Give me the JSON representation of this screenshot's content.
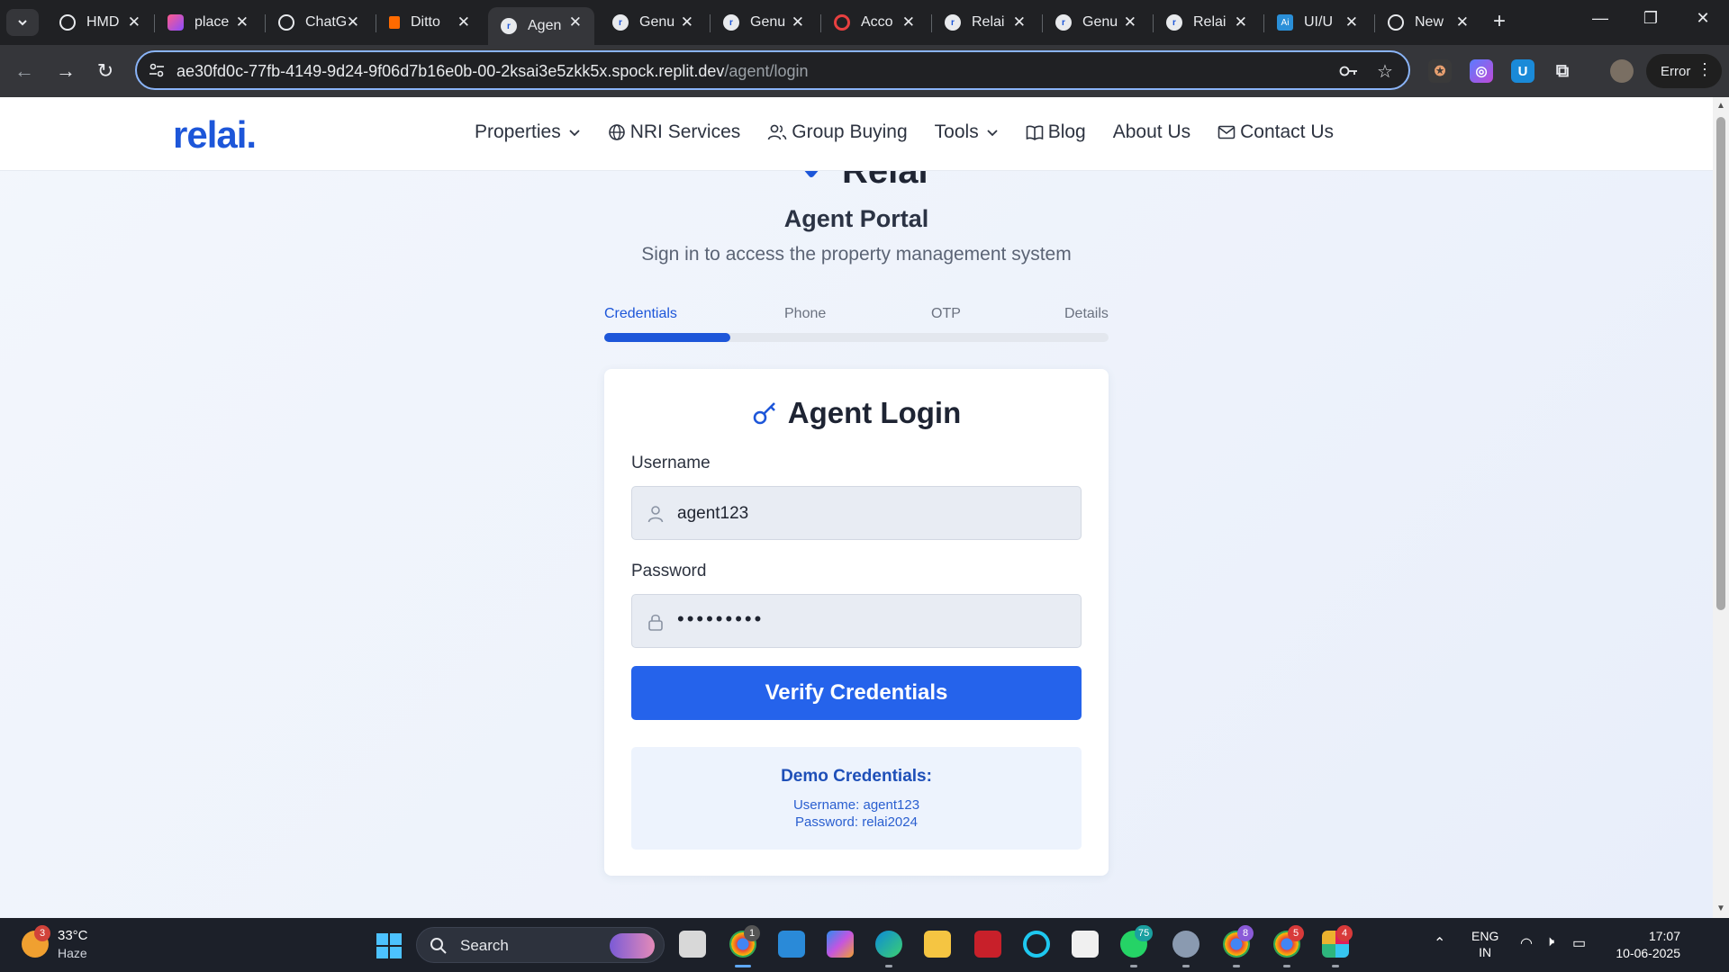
{
  "browser": {
    "tabs": [
      {
        "title": "HMD",
        "active": false
      },
      {
        "title": "place",
        "active": false
      },
      {
        "title": "ChatG",
        "active": false
      },
      {
        "title": "Ditto",
        "active": false
      },
      {
        "title": "Agen",
        "active": true
      },
      {
        "title": "Genu",
        "active": false
      },
      {
        "title": "Genu",
        "active": false
      },
      {
        "title": "Acco",
        "active": false
      },
      {
        "title": "Relai",
        "active": false
      },
      {
        "title": "Genu",
        "active": false
      },
      {
        "title": "Relai",
        "active": false
      },
      {
        "title": "UI/U",
        "active": false
      },
      {
        "title": "New",
        "active": false
      }
    ],
    "url_host": "ae30fd0c-77fb-4149-9d24-9f06d7b16e0b-00-2ksai3e5zkk5x.spock.replit.dev",
    "url_path": "/agent/login",
    "profile_status": "Error"
  },
  "site": {
    "logo": "relai.",
    "nav": {
      "properties": "Properties",
      "nri": "NRI Services",
      "group": "Group Buying",
      "tools": "Tools",
      "blog": "Blog",
      "about": "About Us",
      "contact": "Contact Us"
    },
    "brand_peek": "Relai",
    "portal_title": "Agent Portal",
    "portal_subtitle": "Sign in to access the property management system",
    "steps": {
      "s1": "Credentials",
      "s2": "Phone",
      "s3": "OTP",
      "s4": "Details",
      "progress_fraction": 0.25
    },
    "login": {
      "title": "Agent Login",
      "username_label": "Username",
      "username_value": "agent123",
      "password_label": "Password",
      "password_mask": "•••••••••",
      "submit": "Verify Credentials",
      "demo_heading": "Demo Credentials:",
      "demo_username": "Username: agent123",
      "demo_password": "Password: relai2024"
    }
  },
  "taskbar": {
    "weather_temp": "33°C",
    "weather_cond": "Haze",
    "weather_badge": "3",
    "search": "Search",
    "badges": {
      "chrome": "1",
      "whatsapp": "75",
      "chrome2": "8",
      "chrome3": "5",
      "slack": "4"
    },
    "lang1": "ENG",
    "lang2": "IN",
    "time": "17:07",
    "date": "10-06-2025"
  },
  "colors": {
    "brand_blue": "#1d56d9",
    "button_blue": "#2563eb"
  }
}
